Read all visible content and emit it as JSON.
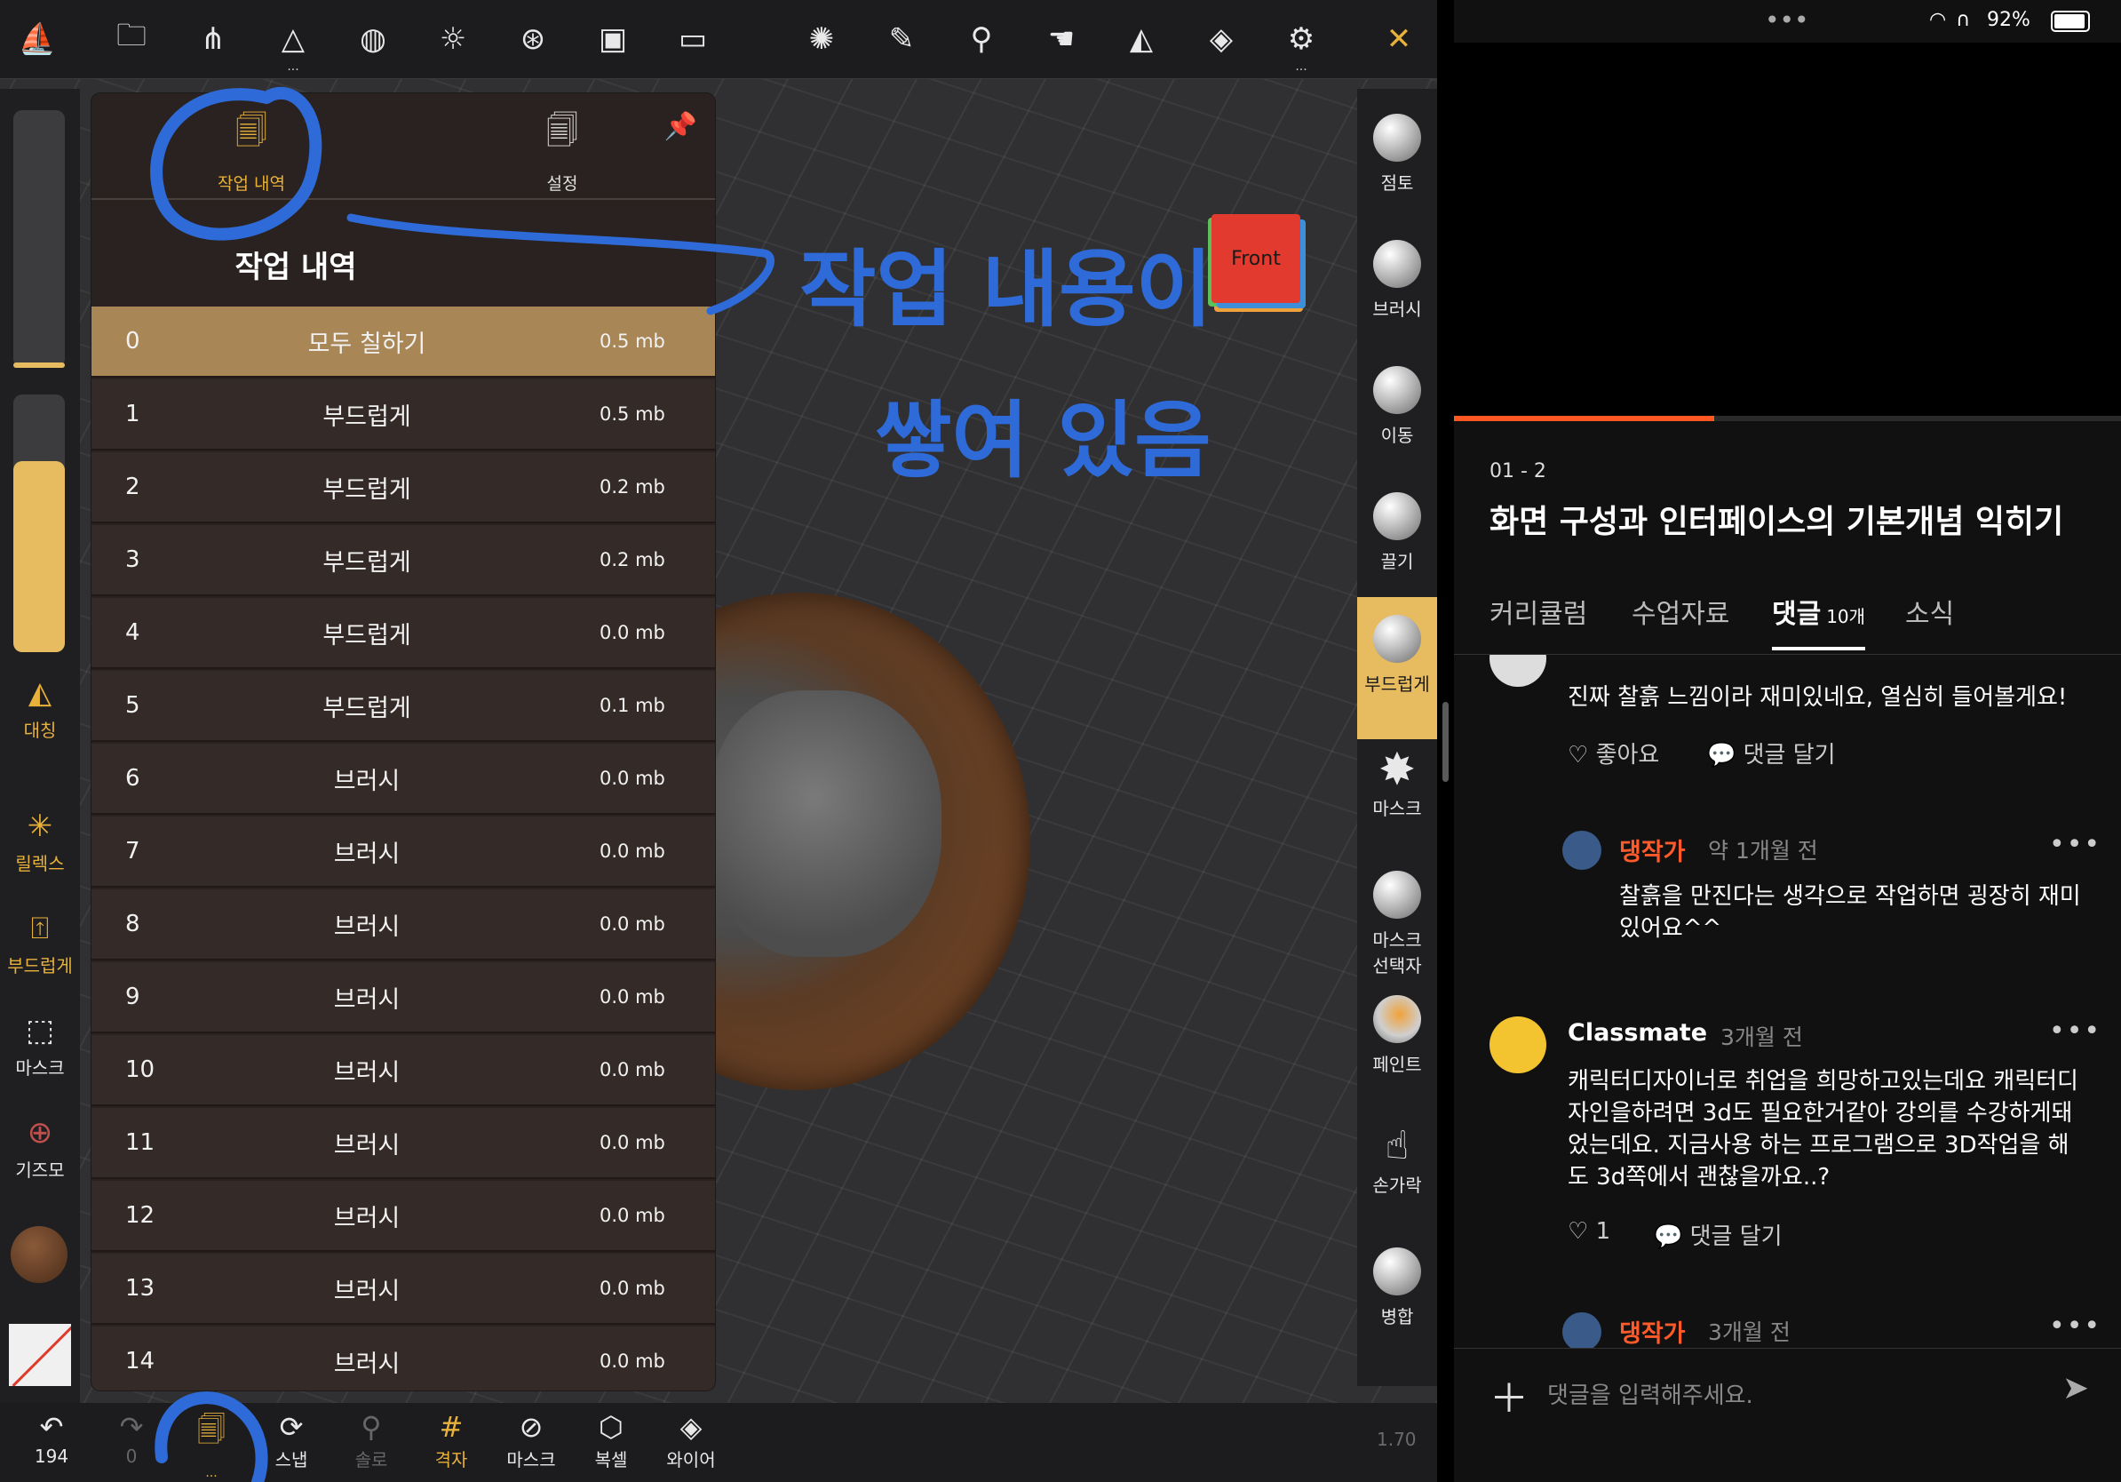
{
  "nomad": {
    "topbar_icons": [
      "logo-icon",
      "folder-icon",
      "share-icon",
      "scene-icon",
      "grid-globe-icon",
      "sun-icon",
      "aperture-icon",
      "image-icon",
      "video-icon",
      "alpha-brush-icon",
      "pen-icon",
      "picker-icon",
      "hand-icon",
      "symmetry-icon",
      "layers-icon",
      "settings-icon",
      "tools-icon"
    ],
    "left_rail": {
      "symmetry_label": "대칭",
      "relax_label": "릴렉스",
      "smooth_label": "부드럽게",
      "mask_label": "마스크",
      "gizmo_label": "기즈모"
    },
    "panel": {
      "tab_history": "작업 내역",
      "tab_settings": "설정",
      "title": "작업 내역",
      "rows": [
        {
          "idx": "0",
          "name": "모두 칠하기",
          "size": "0.5 mb"
        },
        {
          "idx": "1",
          "name": "부드럽게",
          "size": "0.5 mb"
        },
        {
          "idx": "2",
          "name": "부드럽게",
          "size": "0.2 mb"
        },
        {
          "idx": "3",
          "name": "부드럽게",
          "size": "0.2 mb"
        },
        {
          "idx": "4",
          "name": "부드럽게",
          "size": "0.0 mb"
        },
        {
          "idx": "5",
          "name": "부드럽게",
          "size": "0.1 mb"
        },
        {
          "idx": "6",
          "name": "브러시",
          "size": "0.0 mb"
        },
        {
          "idx": "7",
          "name": "브러시",
          "size": "0.0 mb"
        },
        {
          "idx": "8",
          "name": "브러시",
          "size": "0.0 mb"
        },
        {
          "idx": "9",
          "name": "브러시",
          "size": "0.0 mb"
        },
        {
          "idx": "10",
          "name": "브러시",
          "size": "0.0 mb"
        },
        {
          "idx": "11",
          "name": "브러시",
          "size": "0.0 mb"
        },
        {
          "idx": "12",
          "name": "브러시",
          "size": "0.0 mb"
        },
        {
          "idx": "13",
          "name": "브러시",
          "size": "0.0 mb"
        },
        {
          "idx": "14",
          "name": "브러시",
          "size": "0.0 mb"
        }
      ]
    },
    "cube_label": "Front",
    "right_rail": {
      "clay": "점토",
      "brush": "브러시",
      "move": "이동",
      "drag": "끌기",
      "smooth": "부드럽게",
      "mask": "마스크",
      "mask_selector_1": "마스크",
      "mask_selector_2": "선택자",
      "paint": "페인트",
      "finger": "손가락",
      "merge": "병합"
    },
    "bottombar": {
      "undo_count": "194",
      "redo_count": "0",
      "snap": "스냅",
      "solo": "솔로",
      "grid": "격자",
      "mask": "마스크",
      "clone": "복셀",
      "wire": "와이어"
    },
    "version": "1.70",
    "annotation_line1": "작업 내용이",
    "annotation_line2": "쌓여 있음",
    "colors": {
      "accent": "#e8b13a",
      "selected_row": "#a88656",
      "annotation": "#2e6bd8"
    }
  },
  "lecture": {
    "status": {
      "battery": "92%",
      "dots": "•••"
    },
    "progress_fraction": 0.39,
    "lesson_num": "01 - 2",
    "lesson_title": "화면 구성과 인터페이스의 기본개념 익히기",
    "tabs": {
      "curriculum": "커리큘럼",
      "materials": "수업자료",
      "comments": "댓글",
      "comments_count": "10개",
      "news": "소식"
    },
    "comment1": {
      "text": "진짜 찰흙 느낌이라 재미있네요, 열심히 들어볼게요!",
      "like": "좋아요",
      "reply": "댓글 달기"
    },
    "reply1": {
      "author": "댕작가",
      "time": "약 1개월 전",
      "text_line1": "찰흙을 만진다는 생각으로 작업하면 굉장히 재미",
      "text_line2": "있어요^^"
    },
    "comment2": {
      "author": "Classmate",
      "time": "3개월 전",
      "line1": "캐릭터디자이너로 취업을 희망하고있는데요 캐릭터디",
      "line2": "자인을하려면 3d도 필요한거같아 강의를 수강하게돼",
      "line3": "었는데요. 지금사용 하는 프로그램으로 3D작업을 해",
      "line4": "도 3d쪽에서 괜찮을까요..?",
      "like_count": "1",
      "reply": "댓글 달기"
    },
    "reply2": {
      "author": "댕작가",
      "time": "3개월 전"
    },
    "input_placeholder": "댓글을 입력해주세요.",
    "colors": {
      "progress": "#ff5722",
      "author": "#ff5a2a"
    }
  }
}
